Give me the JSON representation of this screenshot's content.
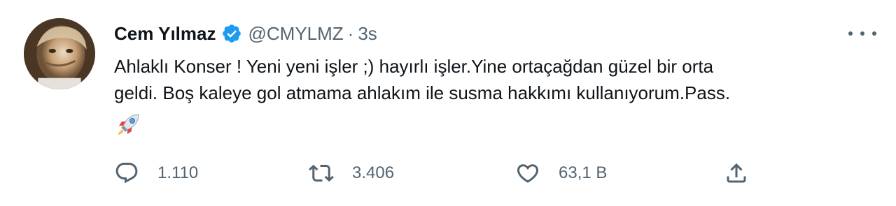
{
  "tweet": {
    "author_name": "Cem Yılmaz",
    "handle": "@CMYLMZ",
    "separator": "·",
    "time": "3s",
    "text": "Ahlaklı Konser ! Yeni yeni işler ;) hayırlı işler.Yine ortaçağdan güzel bir orta\ngeldi. Boş kaleye gol atmama ahlakım ile susma hakkımı kullanıyorum.Pass.",
    "emoji": "rocket-emoji"
  },
  "actions": {
    "reply_count": "1.110",
    "retweet_count": "3.406",
    "like_count": "63,1 B"
  },
  "icons": {
    "verified": "verified-badge-icon",
    "more": "more-options-icon",
    "reply": "reply-icon",
    "retweet": "retweet-icon",
    "like": "heart-icon",
    "share": "share-icon"
  },
  "colors": {
    "text": "#0f1419",
    "secondary": "#536471",
    "verified_blue": "#1d9bf0"
  }
}
